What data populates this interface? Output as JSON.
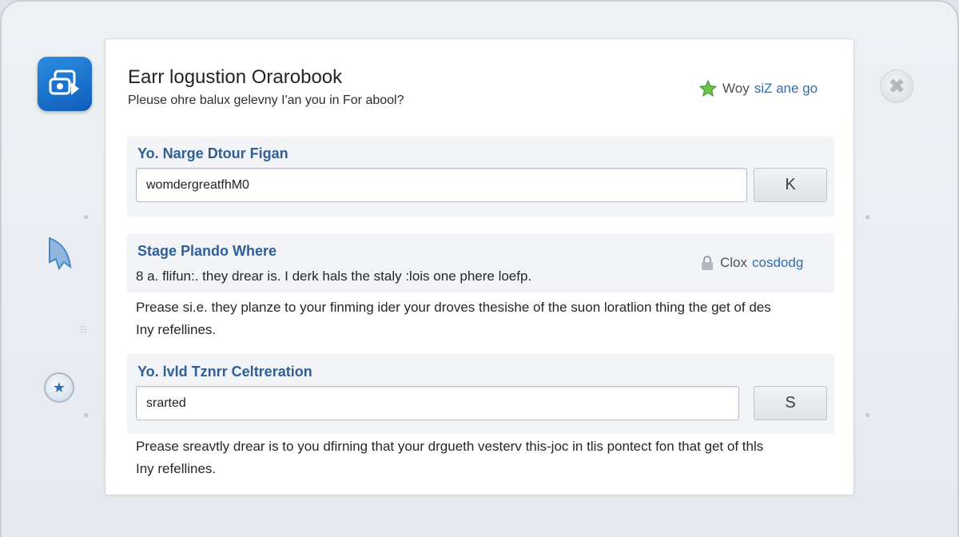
{
  "dialog": {
    "title": "Earr logustion Orarobook",
    "subtitle": "Pleuse ohre balux gelevny I'an you in For abool?",
    "header_link": {
      "muted": "Woy",
      "link": "siZ ane go",
      "icon": "star-icon"
    }
  },
  "section1": {
    "label": "Yo. Narge Dtour Figan",
    "input_value": "womdergreatfhM0",
    "button_label": "K"
  },
  "section2": {
    "label": "Stage Plando Where",
    "line": "8 a. flifun:. they drear is. I derk hals the staly :lois one phere loefp.",
    "aside_muted": "Clox",
    "aside_link": "cosdodg",
    "aside_icon": "lock-icon",
    "note_line1": "Prease si.e. they planze to your finming ider your droves thesishe of the suon loratlion thing the get of des",
    "note_line2": "Iny refellines."
  },
  "section3": {
    "label": "Yo. lvld Tznrr Celtreration",
    "input_value": "srarted",
    "button_label": "S",
    "note_line1": "Prease sreavtly drear is to you dfirning that your drgueth vesterv this-joc in tlis pontect fon that get of thls",
    "note_line2": "Iny refellines."
  },
  "sidebar": {
    "app_icon": "app-logo-icon",
    "feather_icon": "feather-icon",
    "star_icon": "star-circle-icon"
  },
  "window": {
    "close_icon": "close-icon"
  },
  "colors": {
    "accent": "#2f6eb0",
    "label": "#2f5f98",
    "star": "#4caf50"
  }
}
